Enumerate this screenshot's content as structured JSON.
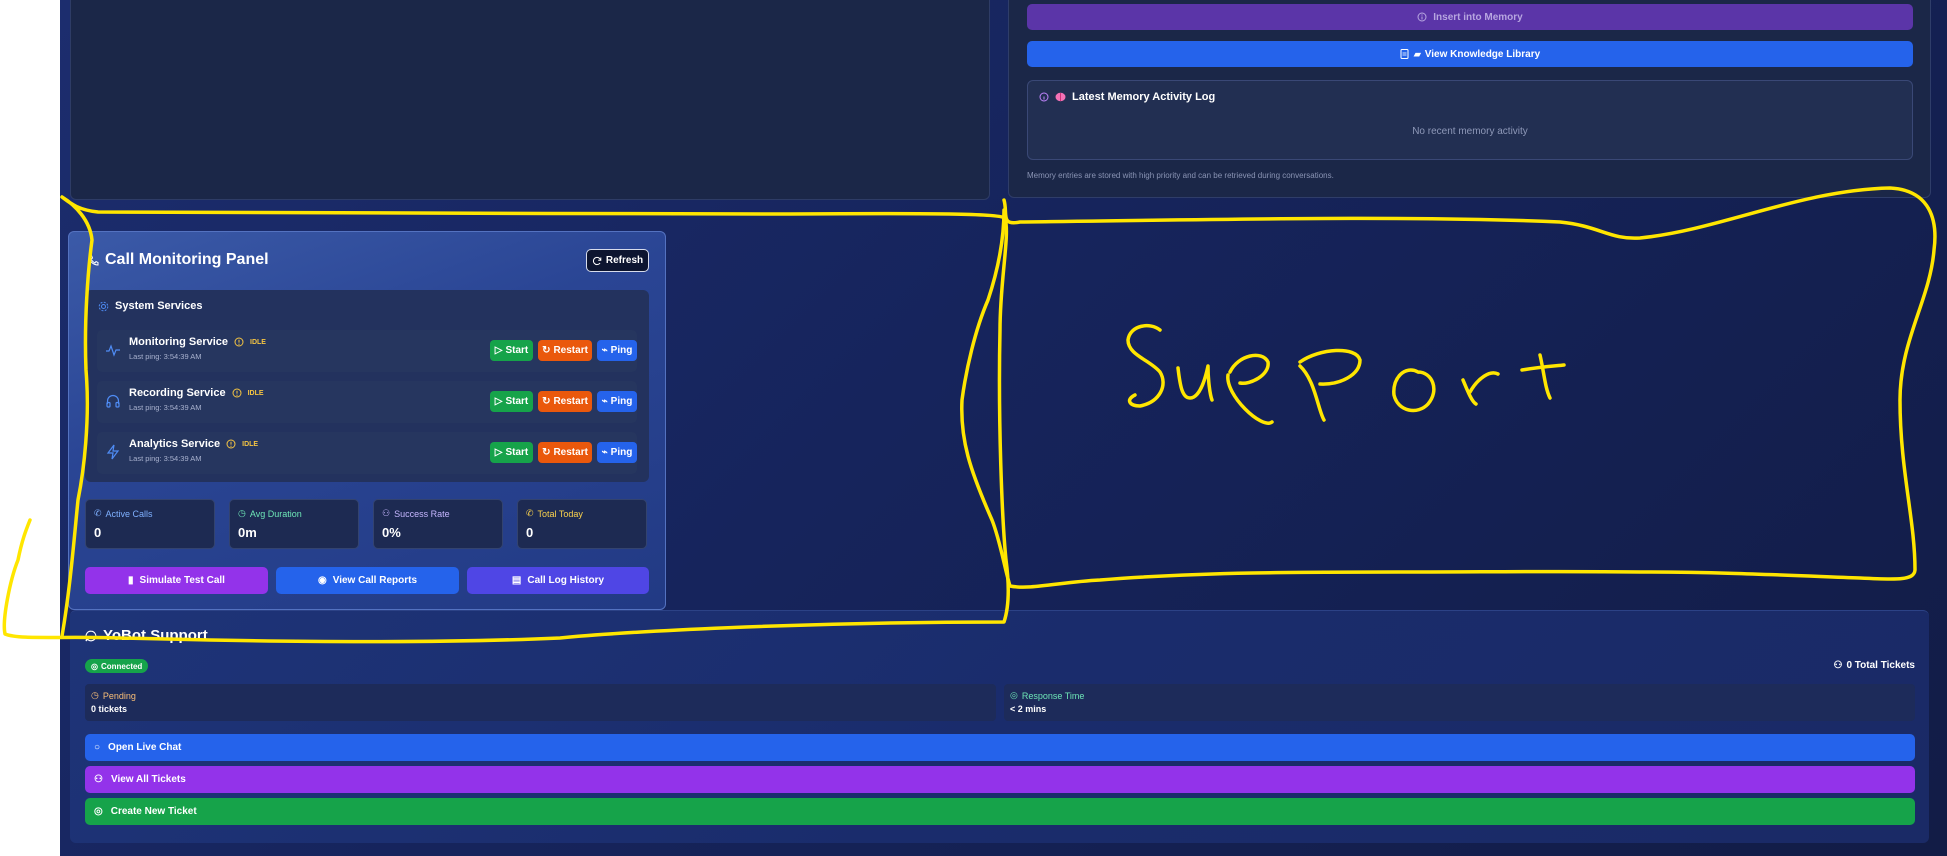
{
  "memory": {
    "insert_label": "Insert into Memory",
    "view_library_label": "View Knowledge Library",
    "log_title": "Latest Memory Activity Log",
    "log_empty": "No recent memory activity",
    "note": "Memory entries are stored with high priority and can be retrieved during conversations."
  },
  "call_panel": {
    "title": "Call Monitoring Panel",
    "refresh_label": "Refresh",
    "services_title": "System Services",
    "services": [
      {
        "name": "Monitoring Service",
        "status": "IDLE",
        "last_ping": "Last ping: 3:54:39 AM",
        "icon": "activity-icon"
      },
      {
        "name": "Recording Service",
        "status": "IDLE",
        "last_ping": "Last ping: 3:54:39 AM",
        "icon": "headphones-icon"
      },
      {
        "name": "Analytics Service",
        "status": "IDLE",
        "last_ping": "Last ping: 3:54:39 AM",
        "icon": "zap-icon"
      }
    ],
    "start_label": "Start",
    "restart_label": "Restart",
    "ping_label": "Ping",
    "stats": [
      {
        "label": "Active Calls",
        "value": "0",
        "color": "#7fb0ff"
      },
      {
        "label": "Avg Duration",
        "value": "0m",
        "color": "#6ee7b7"
      },
      {
        "label": "Success Rate",
        "value": "0%",
        "color": "#c4b5fd"
      },
      {
        "label": "Total Today",
        "value": "0",
        "color": "#fcd34d"
      }
    ],
    "actions": [
      {
        "label": "Simulate Test Call",
        "color": "#9333ea"
      },
      {
        "label": "View Call Reports",
        "color": "#2563eb"
      },
      {
        "label": "Call Log History",
        "color": "#4f46e5"
      }
    ]
  },
  "support": {
    "title": "YoBot Support",
    "status": "Connected",
    "total_tickets": "0 Total Tickets",
    "pending_label": "Pending",
    "pending_value": "0 tickets",
    "response_label": "Response Time",
    "response_value": "< 2 mins",
    "buttons": [
      {
        "label": "Open Live Chat",
        "color": "#2563eb"
      },
      {
        "label": "View All Tickets",
        "color": "#9333ea"
      },
      {
        "label": "Create New Ticket",
        "color": "#16a34a"
      }
    ]
  },
  "annotation": {
    "handwritten_text": "Support",
    "ink_color": "#ffe600"
  }
}
